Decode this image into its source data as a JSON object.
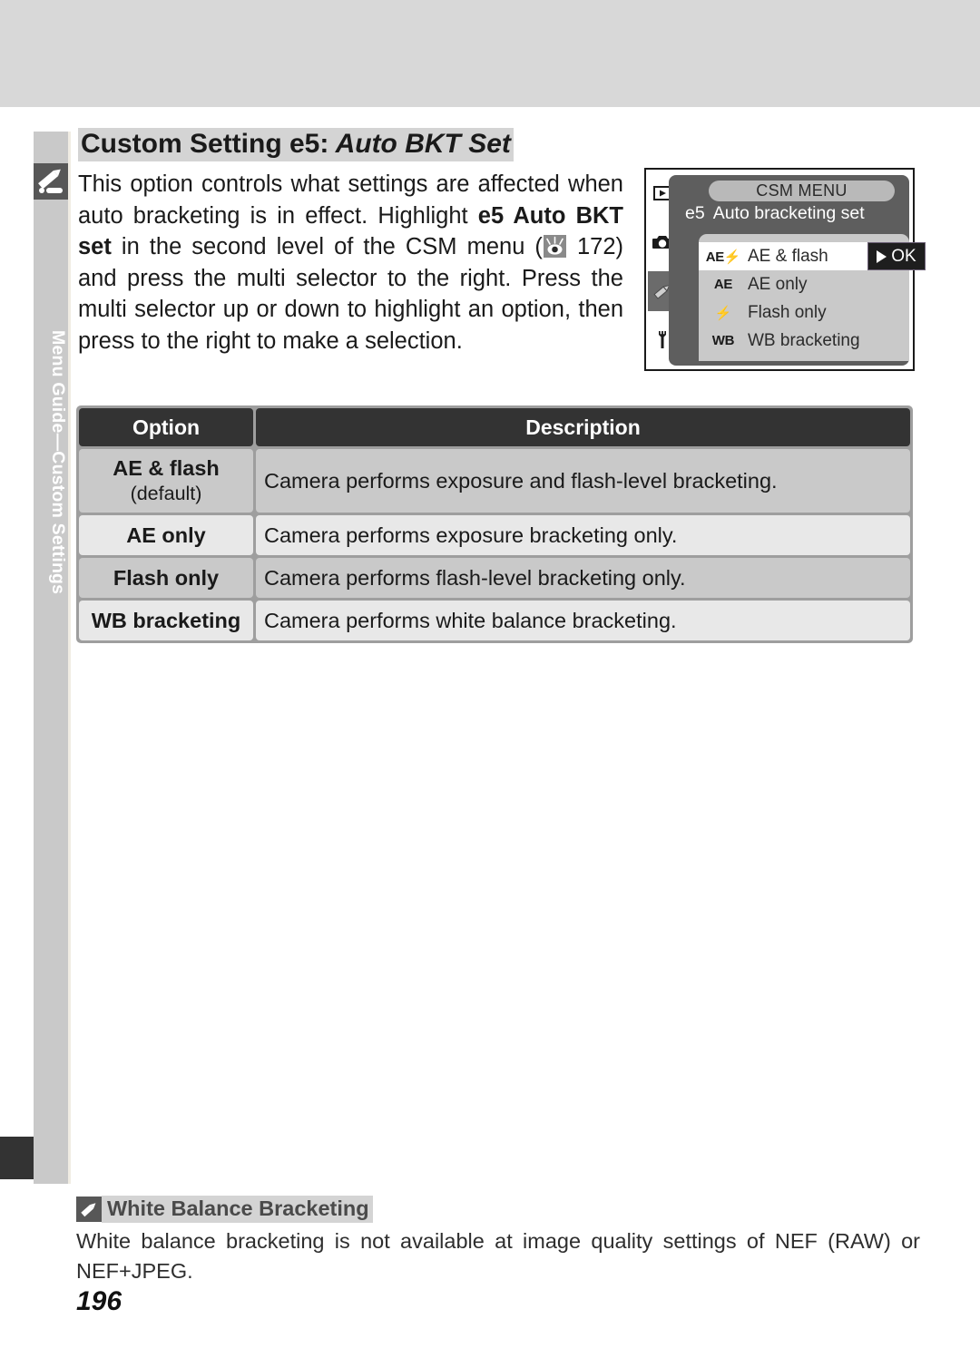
{
  "sidebar": {
    "label": "Menu Guide—Custom Settings",
    "icon": "pencil-note-icon"
  },
  "heading": {
    "prefix": "Custom Setting e5:",
    "italic": " Auto BKT Set"
  },
  "intro": {
    "part1": "This option controls what settings are affected when auto bracketing is in effect.  Highlight ",
    "bold1": "e5 Auto BKT set",
    "part2": " in the second level of the CSM menu (",
    "ref_icon": "reference-eye-icon",
    "page_ref": " 172) and press the multi selector to the right.  Press the multi selector up or down to highlight an option, then press to the right to make a selection."
  },
  "lcd": {
    "title": "CSM MENU",
    "item_code": "e5",
    "item_name": "Auto bracketing set",
    "ok_label": "OK",
    "tabs": [
      {
        "name": "playback-tab-icon",
        "active": false
      },
      {
        "name": "shooting-menu-tab-icon",
        "active": false
      },
      {
        "name": "custom-settings-tab-icon",
        "active": true
      },
      {
        "name": "setup-menu-tab-icon",
        "active": false
      }
    ],
    "rows": [
      {
        "glyph": "AE⚡",
        "label": "AE & flash",
        "selected": true
      },
      {
        "glyph": "AE",
        "label": "AE only",
        "selected": false
      },
      {
        "glyph": "⚡",
        "label": "Flash only",
        "selected": false
      },
      {
        "glyph": "WB",
        "label": "WB bracketing",
        "selected": false
      }
    ]
  },
  "table": {
    "headers": [
      "Option",
      "Description"
    ],
    "rows": [
      {
        "option": "AE & flash",
        "option_sub": "(default)",
        "description": "Camera performs exposure and flash-level bracketing."
      },
      {
        "option": "AE only",
        "option_sub": "",
        "description": "Camera performs exposure bracketing only."
      },
      {
        "option": "Flash only",
        "option_sub": "",
        "description": "Camera performs flash-level bracketing only."
      },
      {
        "option": "WB bracketing",
        "option_sub": "",
        "description": "Camera performs white balance bracketing."
      }
    ]
  },
  "note": {
    "icon": "pencil-note-icon",
    "title": "White Balance Bracketing",
    "body": "White balance bracketing is not available at image quality settings of NEF (RAW) or NEF+JPEG."
  },
  "page_number": "196",
  "colors": {
    "top_band": "#d8d8d8",
    "sidebar": "#c9c9c9",
    "table_header": "#333333",
    "row_dark": "#c9c9c9",
    "row_light": "#e8e8e8",
    "lcd_screen": "#5e5e5e",
    "lcd_list": "#c9c9c9"
  }
}
